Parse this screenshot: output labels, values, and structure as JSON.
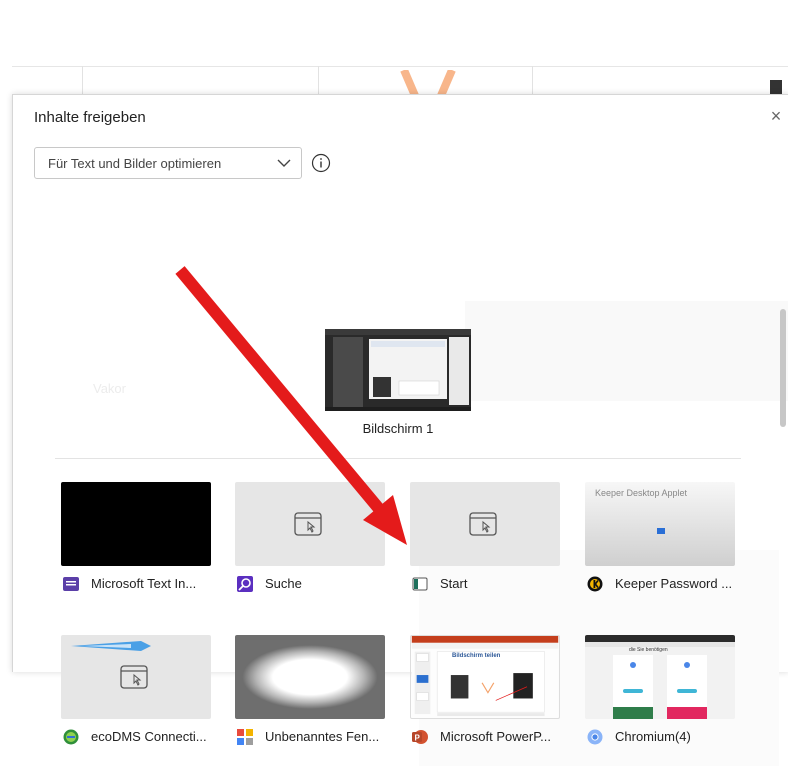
{
  "dialog": {
    "title": "Inhalte freigeben",
    "close_glyph": "×",
    "optimize_select": {
      "selected": "Für Text und Bilder optimieren"
    },
    "info_glyph": "i"
  },
  "background": {
    "ghost_text": "Vakor"
  },
  "screen": {
    "label": "Bildschirm 1"
  },
  "windows": [
    {
      "name": "Microsoft Text In...",
      "icon": "text-input-app-icon",
      "thumb": "black"
    },
    {
      "name": "Suche",
      "icon": "search-app-icon",
      "thumb": "placeholder"
    },
    {
      "name": "Start",
      "icon": "start-app-icon",
      "thumb": "placeholder"
    },
    {
      "name": "Keeper Password ...",
      "icon": "keeper-app-icon",
      "thumb": "keeper",
      "thumb_text": "Keeper Desktop Applet"
    },
    {
      "name": "ecoDMS Connecti...",
      "icon": "ecodms-app-icon",
      "thumb": "placeholder-blue"
    },
    {
      "name": "Unbenanntes Fen...",
      "icon": "generic-window-app-icon",
      "thumb": "blurred"
    },
    {
      "name": "Microsoft PowerP...",
      "icon": "powerpoint-app-icon",
      "thumb": "powerpoint",
      "thumb_text": "Bildschirm teilen"
    },
    {
      "name": "Chromium(4)",
      "icon": "chromium-app-icon",
      "thumb": "chromium",
      "thumb_text": "die Sie benötigen"
    }
  ],
  "colors": {
    "arrow": "#e41b1b",
    "powerpoint": "#c43e1c",
    "chromium": "#4a86e8",
    "accent_orange": "#f4a26a"
  }
}
